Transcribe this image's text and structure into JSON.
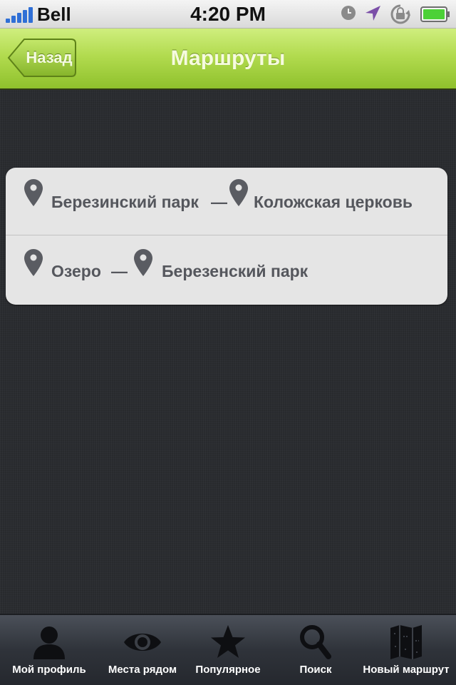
{
  "status_bar": {
    "carrier": "Bell",
    "time": "4:20 PM",
    "icons": [
      "signal-icon",
      "clock-icon",
      "location-arrow-icon",
      "rotation-lock-icon",
      "battery-icon"
    ],
    "signal_color": "#2f6fd6",
    "battery_color": "#4cd137"
  },
  "nav": {
    "back_label": "Назад",
    "title": "Маршруты",
    "accent_color": "#a6d13f"
  },
  "routes": [
    {
      "from": "Березинский парк",
      "separator": "—",
      "to": "Коложская церковь"
    },
    {
      "from": "Озеро",
      "separator": "—",
      "to": "Березенский парк"
    }
  ],
  "tab_bar": {
    "tabs": [
      {
        "label": "Мой профиль",
        "icon": "person-icon"
      },
      {
        "label": "Места рядом",
        "icon": "eye-icon"
      },
      {
        "label": "Популярное",
        "icon": "star-icon"
      },
      {
        "label": "Поиск",
        "icon": "search-icon"
      },
      {
        "label": "Новый маршрут",
        "icon": "map-icon"
      }
    ]
  }
}
